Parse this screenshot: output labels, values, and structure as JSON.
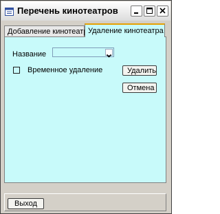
{
  "window": {
    "title": "Перечень кинотеатров",
    "icon": "form-icon"
  },
  "tabs": [
    {
      "label": "Добавление кинотеатра",
      "active": false
    },
    {
      "label": "Удаление кинотеатра",
      "active": true
    }
  ],
  "delete_tab": {
    "name_label": "Название",
    "name_value": "",
    "temp_delete_label": "Временное удаление",
    "temp_delete_checked": false,
    "delete_button": "Удалить",
    "cancel_button": "Отмена"
  },
  "footer": {
    "exit_button": "Выход"
  },
  "colors": {
    "panel_bg": "#c8fafa",
    "window_bg": "#d4d0c8",
    "active_tab_accent": "#e6a000"
  }
}
